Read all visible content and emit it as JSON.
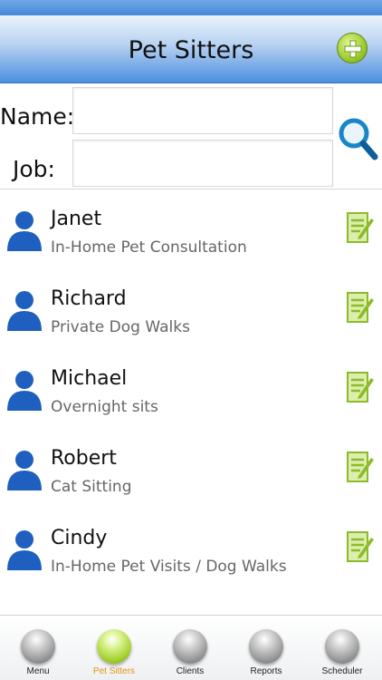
{
  "header": {
    "title": "Pet Sitters",
    "add_icon": "plus-circle-icon",
    "accent": "#4b8fe0"
  },
  "search": {
    "name_label": "Name:",
    "job_label": "Job:",
    "name_value": "",
    "job_value": "",
    "search_icon": "magnifier-icon"
  },
  "sitters": [
    {
      "name": "Janet",
      "job": "In-Home Pet Consultation"
    },
    {
      "name": "Richard",
      "job": "Private Dog Walks"
    },
    {
      "name": "Michael",
      "job": "Overnight sits"
    },
    {
      "name": "Robert",
      "job": "Cat Sitting"
    },
    {
      "name": "Cindy",
      "job": "In-Home Pet Visits / Dog Walks"
    }
  ],
  "tabs": [
    {
      "label": "Menu",
      "active": false
    },
    {
      "label": "Pet Sitters",
      "active": true
    },
    {
      "label": "Clients",
      "active": false
    },
    {
      "label": "Reports",
      "active": false
    },
    {
      "label": "Scheduler",
      "active": false
    }
  ],
  "colors": {
    "active_tab": "#e29413",
    "person_icon": "#1f5fbf",
    "edit_icon": "#8dbb26"
  }
}
